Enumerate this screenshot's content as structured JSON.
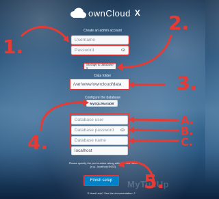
{
  "header": {
    "brand": "ownCloud",
    "brand_suffix": "X"
  },
  "admin": {
    "title": "Create an admin account",
    "username_placeholder": "Username",
    "password_placeholder": "Password"
  },
  "storage": {
    "toggle_label": "Storage & database ▾"
  },
  "data_folder": {
    "label": "Data folder",
    "value": "/var/www/owncloud/data"
  },
  "database": {
    "configure_label": "Configure the database",
    "engine_button": "MySQL/MariaDB",
    "user_placeholder": "Database user",
    "password_placeholder": "Database password",
    "name_placeholder": "Database name",
    "host_value": "localhost"
  },
  "note": "Please specify the port number along with the host name (e.g., localhost:5432).",
  "finish_button": "Finish setup",
  "help_text": "ℹ Need help? See the documentation ↗",
  "watermark": "MyTuxUp",
  "annotations": {
    "n1": "1.",
    "n2": "2.",
    "n3": "3.",
    "n4": "4.",
    "n5": "5.",
    "na": "A.",
    "nb": "B.",
    "nc": "C.",
    "color": "#e53b34"
  }
}
